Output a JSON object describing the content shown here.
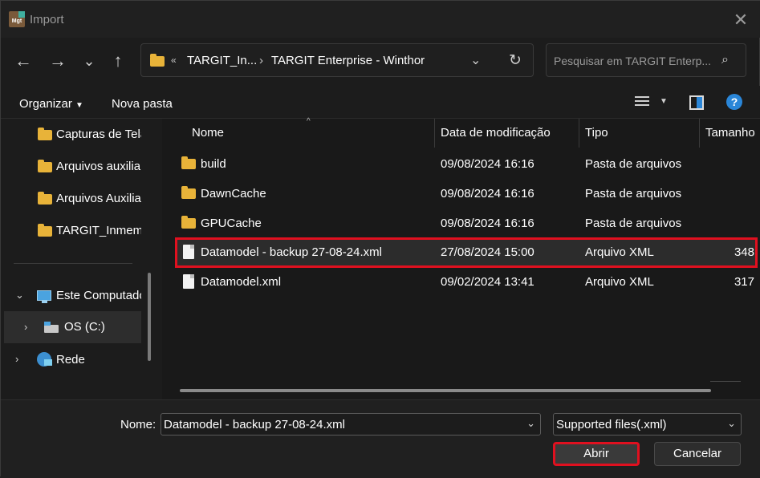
{
  "window": {
    "title": "Import",
    "app_icon_text": "Mgt"
  },
  "nav": {
    "back": "←",
    "forward": "→",
    "recent": "⌄",
    "up": "↑"
  },
  "address": {
    "overflow": "«",
    "segments": [
      "TARGIT_In...",
      "TARGIT Enterprise - Winthor"
    ],
    "separator": "›"
  },
  "search": {
    "placeholder": "Pesquisar em TARGIT Enterp..."
  },
  "toolbar": {
    "organize_label": "Organizar",
    "new_folder_label": "Nova pasta"
  },
  "sidebar": {
    "items": [
      {
        "label": "Capturas de Tela"
      },
      {
        "label": "Arquivos auxilia"
      },
      {
        "label": "Arquivos Auxilia"
      },
      {
        "label": "TARGIT_Inmemo"
      }
    ],
    "this_pc": "Este Computador",
    "drive": "OS (C:)",
    "network": "Rede"
  },
  "filelist": {
    "columns": [
      "Nome",
      "Data de modificação",
      "Tipo",
      "Tamanho"
    ],
    "rows": [
      {
        "name": "build",
        "date": "09/08/2024 16:16",
        "type": "Pasta de arquivos",
        "size": "",
        "kind": "folder"
      },
      {
        "name": "DawnCache",
        "date": "09/08/2024 16:16",
        "type": "Pasta de arquivos",
        "size": "",
        "kind": "folder"
      },
      {
        "name": "GPUCache",
        "date": "09/08/2024 16:16",
        "type": "Pasta de arquivos",
        "size": "",
        "kind": "folder"
      },
      {
        "name": "Datamodel - backup 27-08-24.xml",
        "date": "27/08/2024 15:00",
        "type": "Arquivo XML",
        "size": "348",
        "kind": "file"
      },
      {
        "name": "Datamodel.xml",
        "date": "09/02/2024 13:41",
        "type": "Arquivo XML",
        "size": "317",
        "kind": "file"
      }
    ]
  },
  "footer": {
    "name_label": "Nome:",
    "filename_value": "Datamodel - backup 27-08-24.xml",
    "filetype_value": "Supported files(.xml)",
    "open_label": "Abrir",
    "cancel_label": "Cancelar"
  },
  "colors": {
    "highlight": "#e0101f",
    "folder": "#e8b339",
    "accent": "#2a86d8"
  }
}
